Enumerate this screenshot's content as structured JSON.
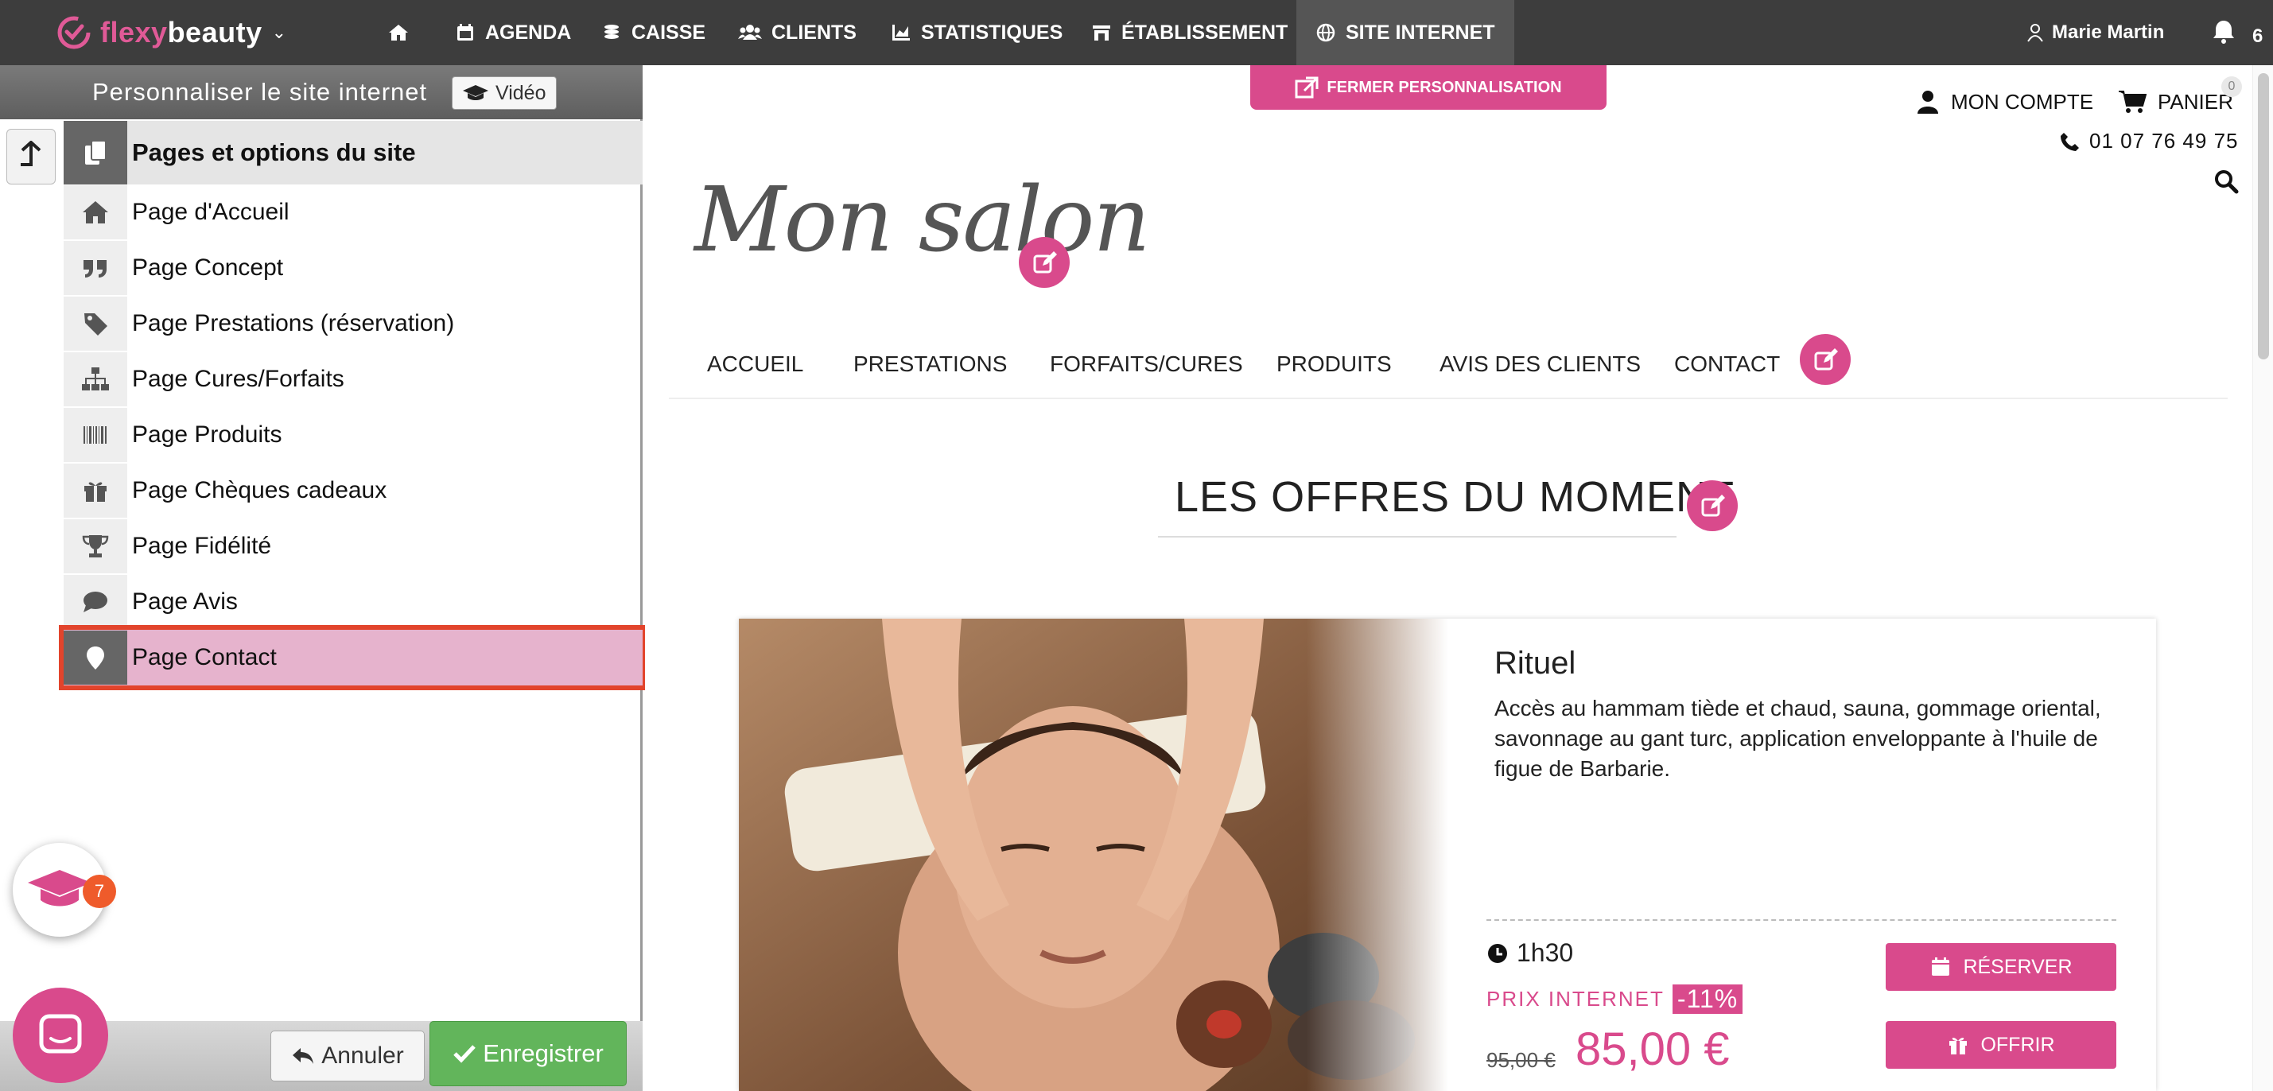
{
  "topbar": {
    "logo_part1": "flexy",
    "logo_part2": "beauty",
    "nav": [
      {
        "label": "",
        "icon": "home-icon"
      },
      {
        "label": "AGENDA",
        "icon": "calendar-icon"
      },
      {
        "label": "CAISSE",
        "icon": "coins-icon"
      },
      {
        "label": "CLIENTS",
        "icon": "users-icon"
      },
      {
        "label": "STATISTIQUES",
        "icon": "chart-icon"
      },
      {
        "label": "ÉTABLISSEMENT",
        "icon": "store-icon"
      },
      {
        "label": "SITE INTERNET",
        "icon": "globe-icon"
      }
    ],
    "user_name": "Marie Martin",
    "notifications": "6",
    "colors": {
      "bar": "#3d3d3d",
      "brand": "#e05a97"
    }
  },
  "panel": {
    "title": "Personnaliser le site internet",
    "video_label": "Vidéo",
    "section_title": "Pages et options du site",
    "items": [
      {
        "label": "Page d'Accueil",
        "icon": "home-icon"
      },
      {
        "label": "Page Concept",
        "icon": "quote-icon"
      },
      {
        "label": "Page Prestations (réservation)",
        "icon": "tag-icon"
      },
      {
        "label": "Page Cures/Forfaits",
        "icon": "sitemap-icon"
      },
      {
        "label": "Page Produits",
        "icon": "barcode-icon"
      },
      {
        "label": "Page Chèques cadeaux",
        "icon": "gift-icon"
      },
      {
        "label": "Page Fidélité",
        "icon": "trophy-icon"
      },
      {
        "label": "Page Avis",
        "icon": "comment-icon"
      },
      {
        "label": "Page Contact",
        "icon": "map-marker-icon",
        "selected": true
      }
    ],
    "cancel_label": "Annuler",
    "save_label": "Enregistrer",
    "tutorial_badge": "7"
  },
  "site": {
    "close_label": "FERMER PERSONNALISATION",
    "account_label": "MON COMPTE",
    "cart_label": "PANIER",
    "cart_count": "0",
    "phone": "01 07 76 49 75",
    "salon_name": "Mon salon",
    "menu": [
      "ACCUEIL",
      "PRESTATIONS",
      "FORFAITS/CURES",
      "PRODUITS",
      "AVIS DES CLIENTS",
      "CONTACT"
    ],
    "offers_title": "LES OFFRES DU MOMENT",
    "offer": {
      "title": "Rituel",
      "description": "Accès au hammam tiède et chaud, sauna, gommage oriental, savonnage au gant turc, application enveloppante à l'huile de figue de Barbarie.",
      "duration": "1h30",
      "price_label": "PRIX INTERNET",
      "discount": "-11%",
      "old_price": "95,00 €",
      "new_price": "85,00 €",
      "book_label": "RÉSERVER",
      "gift_label": "OFFRIR"
    },
    "colors": {
      "accent": "#d94a8c"
    }
  }
}
